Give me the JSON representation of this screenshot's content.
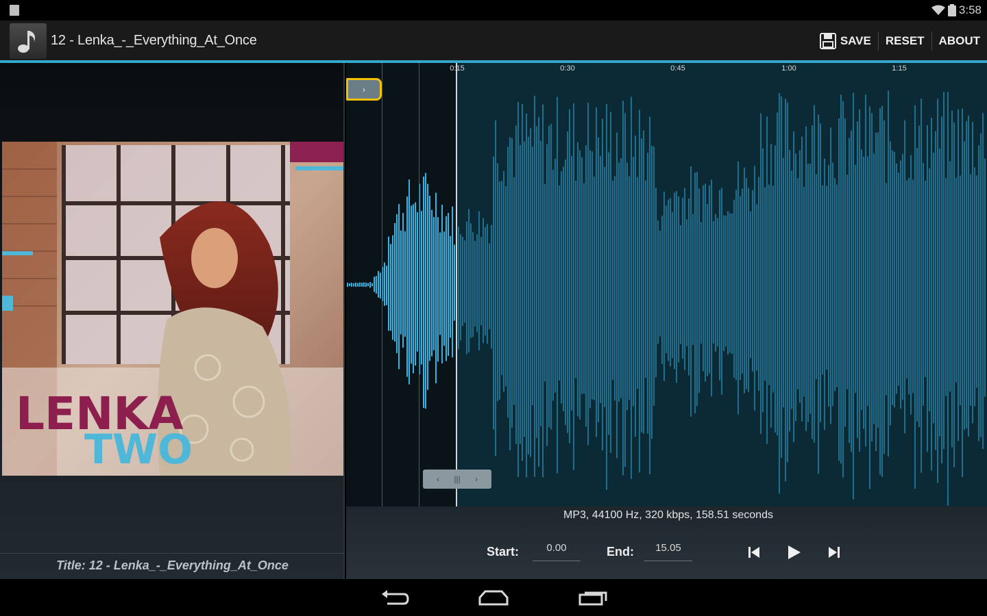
{
  "status_bar": {
    "time": "3:58"
  },
  "action_bar": {
    "file_title": "12 - Lenka_-_Everything_At_Once",
    "actions": {
      "save": "SAVE",
      "reset": "RESET",
      "about": "ABOUT"
    }
  },
  "left_pane": {
    "album_text_line1": "LENKA",
    "album_text_line2": "TWO",
    "caption": "Title: 12 - Lenka_-_Everything_At_Once"
  },
  "timeline": {
    "labels": [
      "0:15",
      "0:30",
      "0:45",
      "1:00",
      "1:15"
    ]
  },
  "info": {
    "file_info": "MP3, 44100 Hz, 320 kbps, 158.51 seconds"
  },
  "controls": {
    "start_label": "Start:",
    "start_value": "0.00",
    "end_label": "End:",
    "end_value": "15.05"
  },
  "colors": {
    "accent": "#33a8cc",
    "selected_wave": "#33b5e5",
    "unselected_wave": "#1f6f8f",
    "start_marker_border": "#f2c200"
  },
  "icons": {
    "app": "music-note-icon",
    "save": "floppy-disk-icon",
    "prev": "skip-previous-icon",
    "play": "play-icon",
    "next": "skip-next-icon",
    "nav_back": "back-icon",
    "nav_home": "home-icon",
    "nav_recents": "recents-icon"
  }
}
